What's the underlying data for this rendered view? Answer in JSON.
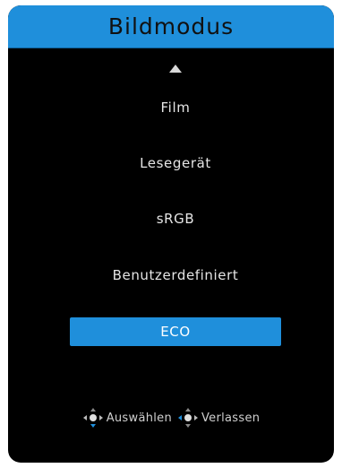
{
  "header": {
    "title": "Bildmodus"
  },
  "scroll": {
    "icon": "triangle-up-icon"
  },
  "menu": {
    "items": [
      {
        "label": "Film",
        "selected": false
      },
      {
        "label": "Lesegerät",
        "selected": false
      },
      {
        "label": "sRGB",
        "selected": false
      },
      {
        "label": "Benutzerdefiniert",
        "selected": false
      },
      {
        "label": "ECO",
        "selected": true
      }
    ]
  },
  "footer": {
    "select_icon": "joystick-down-icon",
    "select_label": "Auswählen",
    "exit_icon": "joystick-left-icon",
    "exit_label": "Verlassen"
  },
  "colors": {
    "accent": "#1f8fdb",
    "background": "#000000",
    "text": "#e6e6e6"
  }
}
